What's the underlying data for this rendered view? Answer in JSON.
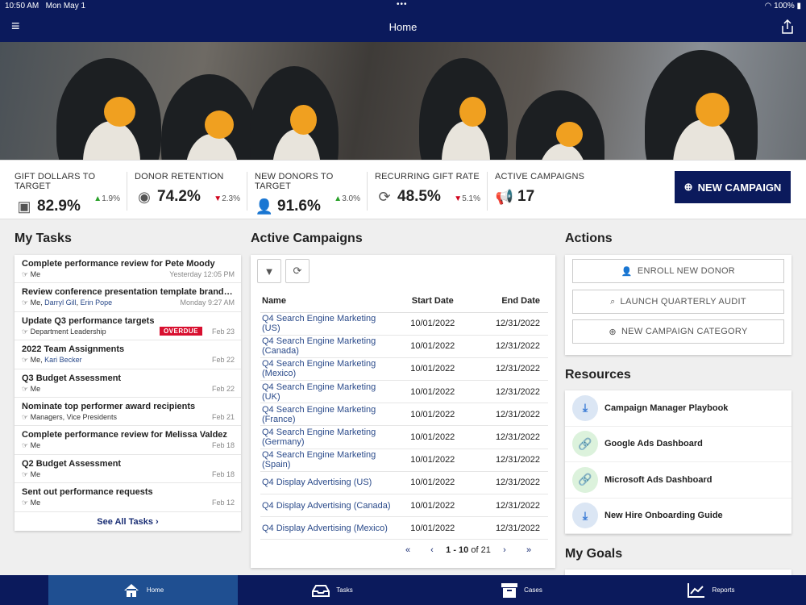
{
  "status": {
    "time": "10:50 AM",
    "date": "Mon May 1",
    "battery": "100%"
  },
  "header": {
    "title": "Home"
  },
  "kpis": [
    {
      "label": "GIFT DOLLARS TO TARGET",
      "value": "82.9%",
      "change": "1.9%",
      "direction": "up",
      "icon": "money-icon"
    },
    {
      "label": "DONOR RETENTION",
      "value": "74.2%",
      "change": "2.3%",
      "direction": "down",
      "icon": "user-circle-icon"
    },
    {
      "label": "NEW DONORS TO TARGET",
      "value": "91.6%",
      "change": "3.0%",
      "direction": "up",
      "icon": "user-plus-icon"
    },
    {
      "label": "RECURRING GIFT RATE",
      "value": "48.5%",
      "change": "5.1%",
      "direction": "down",
      "icon": "refresh-icon"
    },
    {
      "label": "ACTIVE CAMPAIGNS",
      "value": "17",
      "icon": "megaphone-icon"
    }
  ],
  "new_campaign": "NEW CAMPAIGN",
  "tasks": {
    "title": "My Tasks",
    "see_all": "See All Tasks",
    "items": [
      {
        "title": "Complete performance review for Pete Moody",
        "who": "Me",
        "date": "Yesterday 12:05 PM"
      },
      {
        "title": "Review conference presentation template brandin...",
        "who": "Me, ",
        "links": [
          "Darryl Gill",
          "Erin Pope"
        ],
        "date": "Monday 9:27 AM"
      },
      {
        "title": "Update Q3 performance targets",
        "who": "Department Leadership",
        "badge": "OVERDUE",
        "date": "Feb 23"
      },
      {
        "title": "2022 Team Assignments",
        "who": "Me, ",
        "links": [
          "Kari Becker"
        ],
        "date": "Feb 22"
      },
      {
        "title": "Q3 Budget Assessment",
        "who": "Me",
        "date": "Feb 22"
      },
      {
        "title": "Nominate top performer award recipients",
        "who": "Managers, Vice Presidents",
        "date": "Feb 21"
      },
      {
        "title": "Complete performance review for Melissa Valdez",
        "who": "Me",
        "date": "Feb 18"
      },
      {
        "title": "Q2 Budget Assessment",
        "who": "Me",
        "date": "Feb 18"
      },
      {
        "title": "Sent out performance requests",
        "who": "Me",
        "date": "Feb 12"
      }
    ]
  },
  "campaigns": {
    "title": "Active Campaigns",
    "columns": [
      "Name",
      "Start Date",
      "End Date"
    ],
    "rows": [
      [
        "Q4 Search Engine Marketing (US)",
        "10/01/2022",
        "12/31/2022"
      ],
      [
        "Q4 Search Engine Marketing (Canada)",
        "10/01/2022",
        "12/31/2022"
      ],
      [
        "Q4 Search Engine Marketing (Mexico)",
        "10/01/2022",
        "12/31/2022"
      ],
      [
        "Q4 Search Engine Marketing (UK)",
        "10/01/2022",
        "12/31/2022"
      ],
      [
        "Q4 Search Engine Marketing (France)",
        "10/01/2022",
        "12/31/2022"
      ],
      [
        "Q4 Search Engine Marketing (Germany)",
        "10/01/2022",
        "12/31/2022"
      ],
      [
        "Q4 Search Engine Marketing (Spain)",
        "10/01/2022",
        "12/31/2022"
      ],
      [
        "Q4 Display Advertising (US)",
        "10/01/2022",
        "12/31/2022"
      ],
      [
        "Q4 Display Advertising (Canada)",
        "10/01/2022",
        "12/31/2022"
      ],
      [
        "Q4 Display Advertising (Mexico)",
        "10/01/2022",
        "12/31/2022"
      ]
    ],
    "pager": {
      "range": "1 - 10",
      "of": "of 21"
    }
  },
  "actions": {
    "title": "Actions",
    "items": [
      "ENROLL NEW DONOR",
      "LAUNCH QUARTERLY AUDIT",
      "NEW CAMPAIGN CATEGORY"
    ]
  },
  "resources": {
    "title": "Resources",
    "items": [
      {
        "label": "Campaign Manager Playbook",
        "type": "download"
      },
      {
        "label": "Google Ads Dashboard",
        "type": "link"
      },
      {
        "label": "Microsoft Ads Dashboard",
        "type": "link"
      },
      {
        "label": "New Hire Onboarding Guide",
        "type": "download"
      }
    ]
  },
  "goals": {
    "title": "My Goals"
  },
  "tabs": [
    "Home",
    "Tasks",
    "Cases",
    "Reports"
  ],
  "colors": {
    "navy": "#0b1a5c",
    "active_tab": "#1f4f91",
    "overdue": "#d80f2f",
    "up": "#2aa12a",
    "down": "#d0021b"
  }
}
